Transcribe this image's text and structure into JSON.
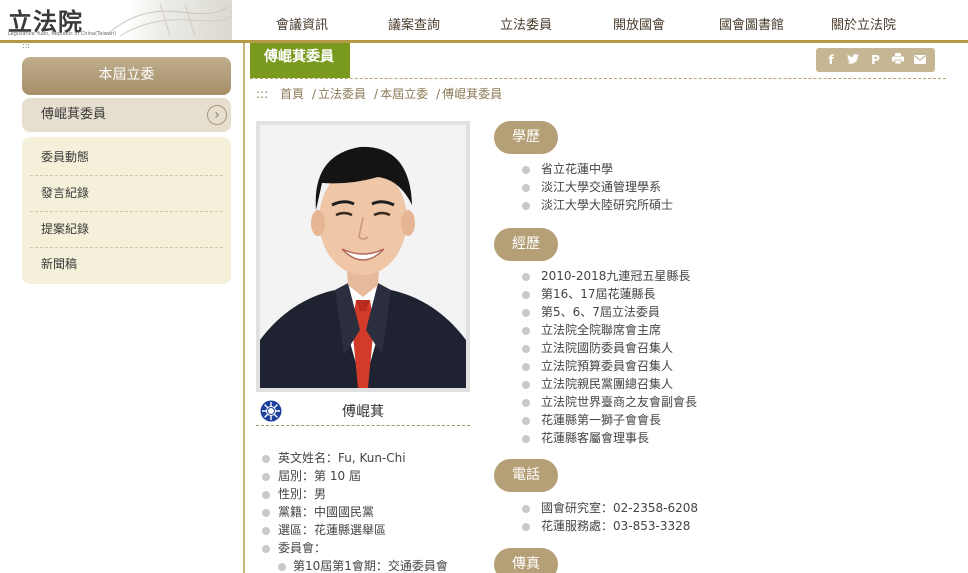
{
  "colors": {
    "gold": "#b59a46",
    "olive_tab": "#7a9a1f",
    "section_label": "#b59f77",
    "sidebar_head": "#a78e69"
  },
  "logo": {
    "text": "立法院",
    "subtitle": "Legislative Yuan, Republic of China(Taiwan)"
  },
  "nav": [
    "會議資訊",
    "議案查詢",
    "立法委員",
    "開放國會",
    "國會圖書館",
    "關於立法院"
  ],
  "sidebar": {
    "dots": ":::",
    "title": "本屆立委",
    "current": "傅崐萁委員",
    "current_icon": "chevron-right-icon",
    "items": [
      "委員動態",
      "發言紀錄",
      "提案紀錄",
      "新聞稿"
    ]
  },
  "main": {
    "tab": "傅崐萁委員",
    "share_icons": [
      "facebook-icon",
      "twitter-icon",
      "plurk-icon",
      "print-icon",
      "mail-icon"
    ],
    "breadcrumb": {
      "dots": ":::",
      "items": [
        "首頁",
        "立法委員",
        "本屆立委",
        "傅崐萁委員"
      ]
    }
  },
  "profile": {
    "name": "傅崐萁",
    "party_icon": "kmt-emblem-icon",
    "info": [
      "英文姓名：Fu, Kun-Chi",
      "屆別：第 10 屆",
      "性別：男",
      "黨籍：中國國民黨",
      "選區：花蓮縣選舉區",
      "委員會："
    ],
    "committees": [
      "第10屆第1會期：交通委員會"
    ]
  },
  "sections": {
    "education": {
      "label": "學歷",
      "items": [
        "省立花蓮中學",
        "淡江大學交通管理學系",
        "淡江大學大陸研究所碩士"
      ]
    },
    "experience": {
      "label": "經歷",
      "items": [
        "2010-2018九連冠五星縣長",
        "第16、17屆花蓮縣長",
        "第5、6、7屆立法委員",
        "立法院全院聯席會主席",
        "立法院國防委員會召集人",
        "立法院預算委員會召集人",
        "立法院親民黨團總召集人",
        "立法院世界臺商之友會副會長",
        "花蓮縣第一獅子會會長",
        "花蓮縣客屬會理事長"
      ]
    },
    "phone": {
      "label": "電話",
      "items": [
        "國會研究室：02-2358-6208",
        "花蓮服務處：03-853-3328"
      ]
    },
    "fax": {
      "label": "傳真",
      "items": []
    }
  }
}
